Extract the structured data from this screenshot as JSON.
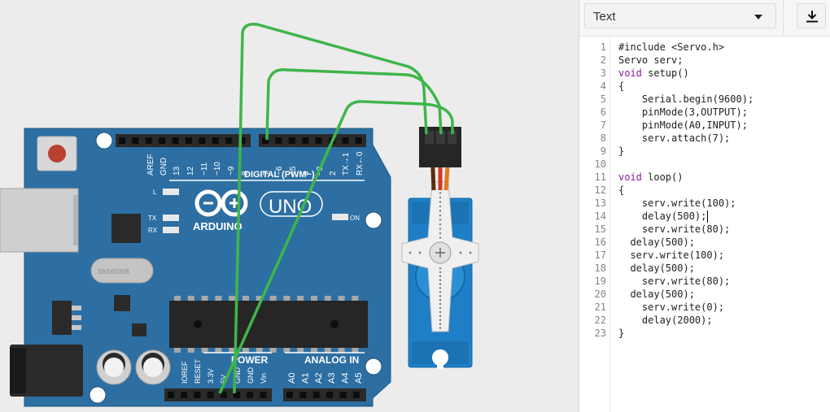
{
  "editor": {
    "mode_label": "Text",
    "download_icon": "download-icon",
    "cursor_line": 14,
    "code_lines": [
      "#include <Servo.h>",
      "Servo serv;",
      "void setup()",
      "{",
      "    Serial.begin(9600);",
      "    pinMode(3,OUTPUT);",
      "    pinMode(A0,INPUT);",
      "    serv.attach(7);",
      "}",
      "",
      "void loop()",
      "{",
      "    serv.write(100);",
      "    delay(500);",
      "    serv.write(80);",
      "  delay(500);",
      "  serv.write(100);",
      "  delay(500);",
      "    serv.write(80);",
      "  delay(500);",
      "    serv.write(0);",
      "    delay(2000);",
      "}"
    ]
  },
  "board": {
    "name": "UNO",
    "brand": "ARDUINO",
    "digital_header": "DIGITAL (PWM~)",
    "power_header": "POWER",
    "analog_header": "ANALOG IN",
    "on_label": "ON",
    "l_label": "L",
    "tx_label": "TX",
    "rx_label": "RX",
    "crystal_label": "SN16000B",
    "digital_pins": [
      "AREF",
      "GND",
      "13",
      "12",
      "~11",
      "~10",
      "~9",
      "8",
      "7",
      "~6",
      "~5",
      "4",
      "~3",
      "2",
      "TX→1",
      "RX←0"
    ],
    "power_pins": [
      "IOREF",
      "RESET",
      "3.3V",
      "5V",
      "GND",
      "GND",
      "Vin"
    ],
    "analog_pins": [
      "A0",
      "A1",
      "A2",
      "A3",
      "A4",
      "A5"
    ]
  },
  "colors": {
    "board": "#2d6fa3",
    "wire": "#3fb54a",
    "servo": "#1e7fc6",
    "keyword": "#8a1a9c"
  }
}
